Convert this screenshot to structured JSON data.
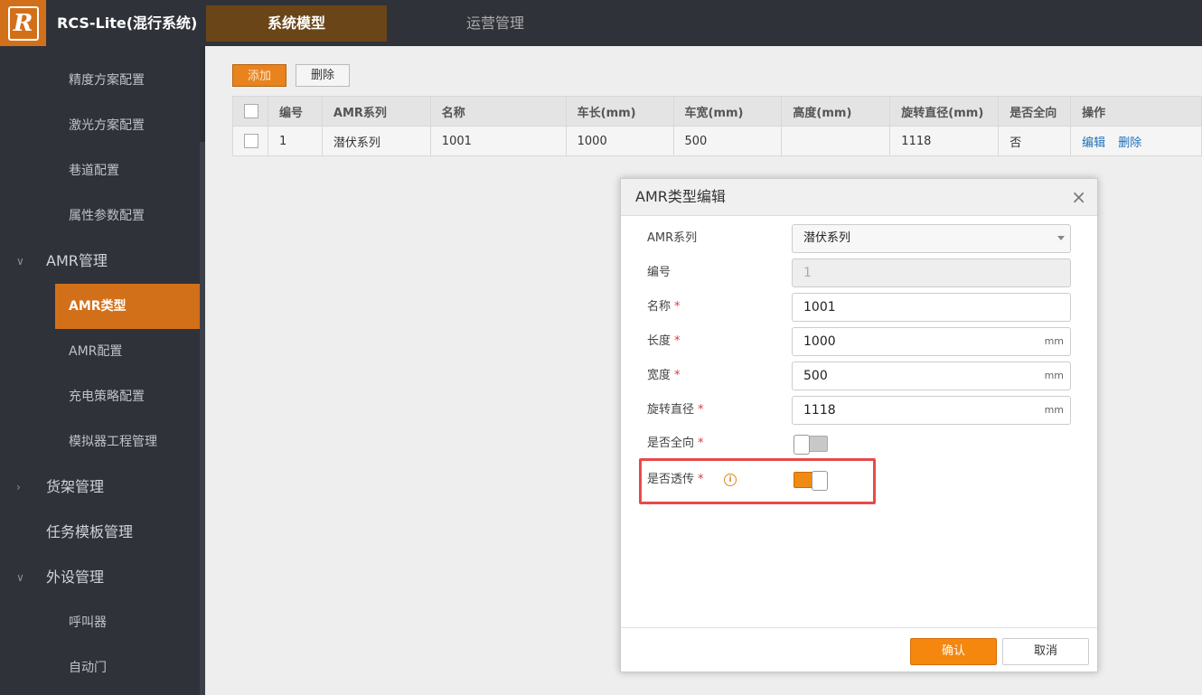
{
  "app": {
    "logo_letter": "R",
    "title": "RCS-Lite(混行系统)"
  },
  "nav": {
    "tabs": [
      "系统模型",
      "运营管理"
    ]
  },
  "sidebar": {
    "items": [
      {
        "label": "精度方案配置",
        "level": "sub"
      },
      {
        "label": "激光方案配置",
        "level": "sub"
      },
      {
        "label": "巷道配置",
        "level": "sub"
      },
      {
        "label": "属性参数配置",
        "level": "sub"
      },
      {
        "label": "AMR管理",
        "level": "group",
        "expanded": true
      },
      {
        "label": "AMR类型",
        "level": "sub",
        "active": true
      },
      {
        "label": "AMR配置",
        "level": "sub"
      },
      {
        "label": "充电策略配置",
        "level": "sub"
      },
      {
        "label": "模拟器工程管理",
        "level": "sub"
      },
      {
        "label": "货架管理",
        "level": "group",
        "expanded": false
      },
      {
        "label": "任务模板管理",
        "level": "group"
      },
      {
        "label": "外设管理",
        "level": "group",
        "expanded": true
      },
      {
        "label": "呼叫器",
        "level": "sub"
      },
      {
        "label": "自动门",
        "level": "sub"
      }
    ]
  },
  "toolbar": {
    "add_label": "添加",
    "delete_label": "删除"
  },
  "table": {
    "headers": [
      "编号",
      "AMR系列",
      "名称",
      "车长(mm)",
      "车宽(mm)",
      "高度(mm)",
      "旋转直径(mm)",
      "是否全向",
      "操作"
    ],
    "rows": [
      {
        "id": "1",
        "series": "潜伏系列",
        "name": "1001",
        "length": "1000",
        "width": "500",
        "height": "",
        "diameter": "1118",
        "omni": "否",
        "edit": "编辑",
        "delete": "删除"
      }
    ]
  },
  "modal": {
    "title": "AMR类型编辑",
    "close": "×",
    "fields": {
      "series": {
        "label": "AMR系列",
        "value": "潜伏系列"
      },
      "code": {
        "label": "编号",
        "value": "1"
      },
      "name": {
        "label": "名称",
        "value": "1001",
        "required": "*"
      },
      "length": {
        "label": "长度",
        "value": "1000",
        "unit": "mm",
        "required": "*"
      },
      "width": {
        "label": "宽度",
        "value": "500",
        "unit": "mm",
        "required": "*"
      },
      "diameter": {
        "label": "旋转直径",
        "value": "1118",
        "unit": "mm",
        "required": "*"
      },
      "omni": {
        "label": "是否全向",
        "required": "*",
        "on": false
      },
      "passthrough": {
        "label": "是否透传",
        "required": "*",
        "info": "i",
        "on": true
      }
    },
    "ok_label": "确认",
    "cancel_label": "取消"
  },
  "colors": {
    "accent": "#e8831d",
    "highlight": "#e84a4a",
    "link": "#1f6fb8"
  }
}
